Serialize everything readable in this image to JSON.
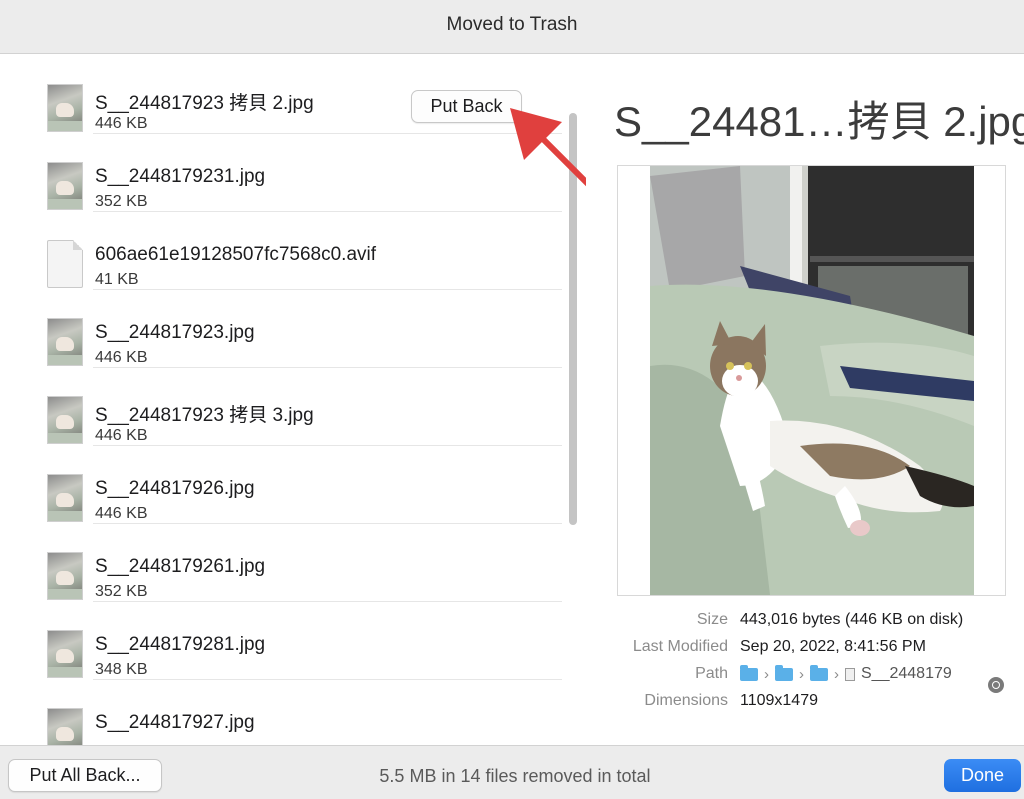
{
  "window": {
    "title": "Moved to Trash"
  },
  "files": [
    {
      "name": "S__244817923 拷貝 2.jpg",
      "size": "446 KB",
      "icon": "photo-icon"
    },
    {
      "name": "S__2448179231.jpg",
      "size": "352 KB",
      "icon": "photo-icon"
    },
    {
      "name": "606ae61e19128507fc7568c0.avif",
      "size": "41 KB",
      "icon": "document-icon"
    },
    {
      "name": "S__244817923.jpg",
      "size": "446 KB",
      "icon": "photo-icon"
    },
    {
      "name": "S__244817923 拷貝 3.jpg",
      "size": "446 KB",
      "icon": "photo-icon"
    },
    {
      "name": "S__244817926.jpg",
      "size": "446 KB",
      "icon": "photo-icon"
    },
    {
      "name": "S__2448179261.jpg",
      "size": "352 KB",
      "icon": "photo-icon"
    },
    {
      "name": "S__2448179281.jpg",
      "size": "348 KB",
      "icon": "photo-icon"
    },
    {
      "name": "S__244817927.jpg",
      "size": "",
      "icon": "photo-icon"
    }
  ],
  "row_action": {
    "put_back_label": "Put Back"
  },
  "preview": {
    "title": "S__24481…拷貝 2.jpg",
    "meta": {
      "size_label": "Size",
      "size_value": "443,016 bytes (446 KB on disk)",
      "modified_label": "Last Modified",
      "modified_value": "Sep 20, 2022, 8:41:56 PM",
      "path_label": "Path",
      "path_file": "S__2448179",
      "dimensions_label": "Dimensions",
      "dimensions_value": "1109x1479"
    }
  },
  "footer": {
    "put_all_back_label": "Put All Back...",
    "status": "5.5 MB in 14 files removed in total",
    "done_label": "Done"
  },
  "colors": {
    "accent": "#1f6fe0",
    "arrow": "#e0403e",
    "folder": "#5ab0e8"
  }
}
